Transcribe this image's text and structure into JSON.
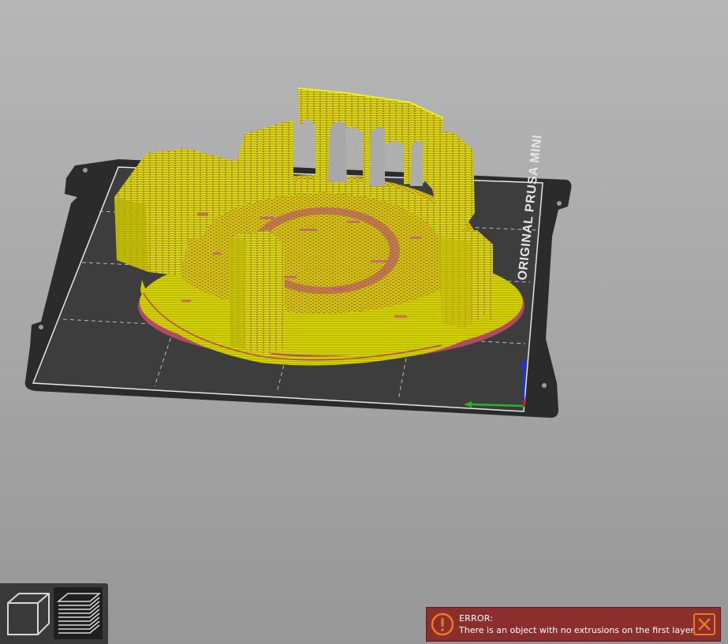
{
  "viewport": {
    "bed_label": "ORIGINAL PRUSA MINI",
    "colors": {
      "background_top": "#b6b6b6",
      "background_bottom": "#979797",
      "bed_surface": "#3d3d3d",
      "bed_frame": "#2b2b2b",
      "model_primary": "#d4d400",
      "model_highlight": "#e6e600",
      "model_accent": "#c45a7a",
      "axis_x": "#2ab32a",
      "axis_z": "#2233dd"
    }
  },
  "view_toolbar": {
    "buttons": [
      {
        "name": "3d-view",
        "icon": "cube-icon",
        "active": false
      },
      {
        "name": "preview",
        "icon": "layers-icon",
        "active": true
      }
    ]
  },
  "notification": {
    "level": "error",
    "title": "ERROR:",
    "message": "There is an object with no extrusions on the first layer.",
    "icon": "exclamation-circle-icon",
    "close_icon": "close-icon",
    "color": "#8a2e2e",
    "accent": "#f07a1a"
  }
}
